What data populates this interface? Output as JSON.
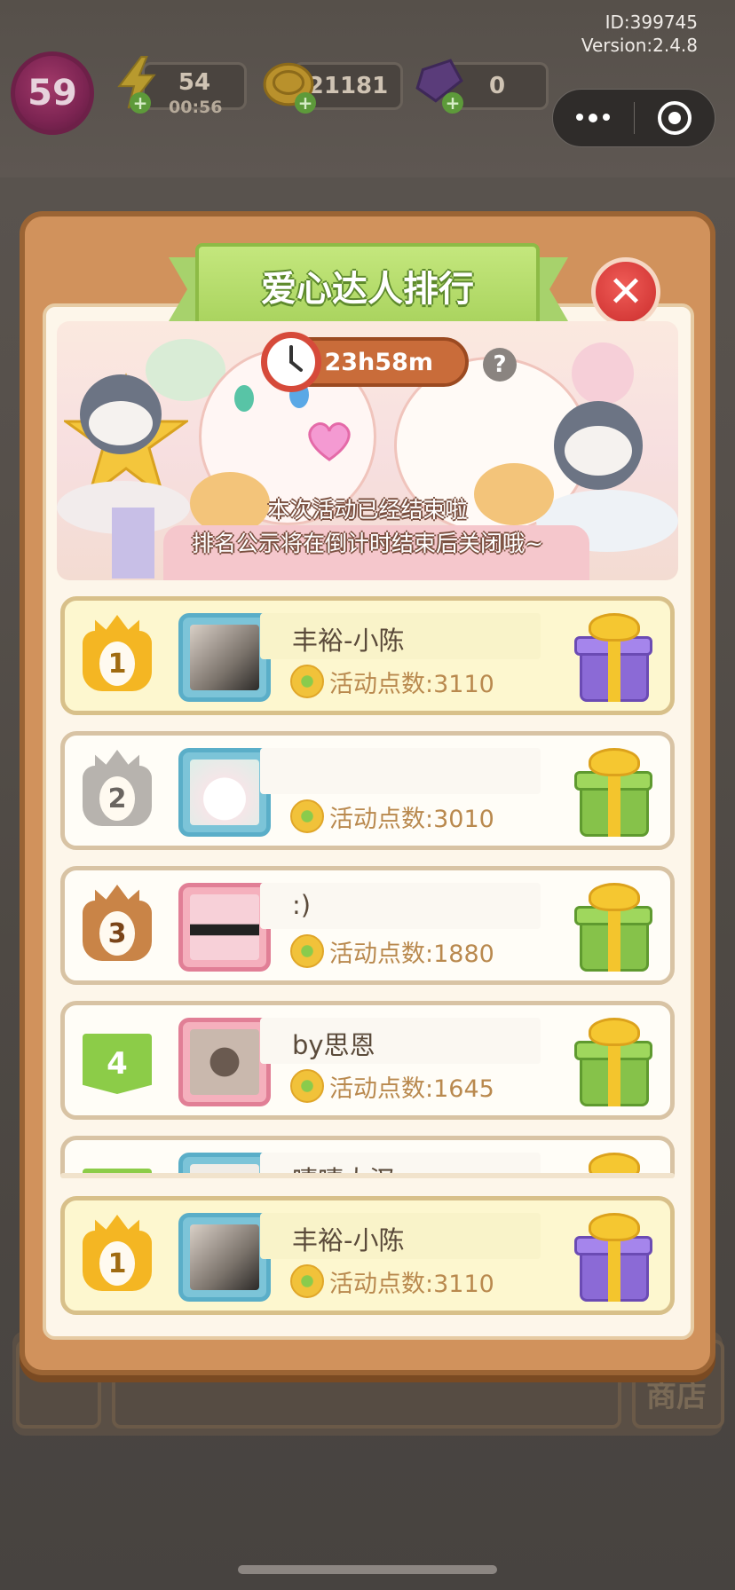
{
  "status_bar": {
    "id_text": "ID:399745",
    "version_text": "Version:2.4.8",
    "level": "59",
    "energy": "54",
    "energy_timer": "00:56",
    "coins": "21181",
    "gems": "0",
    "plus_icon": "plus-icon"
  },
  "capsule": {
    "more_icon": "more-dots-icon",
    "close_icon": "target-close-icon"
  },
  "modal": {
    "title": "爱心达人排行",
    "close_glyph": "✕",
    "countdown": "23h58m",
    "help_glyph": "?",
    "notice_line1": "本次活动已经结束啦",
    "notice_line2": "排名公示将在倒计时结束后关闭哦~"
  },
  "ranking": {
    "rows": [
      {
        "rank": "1",
        "name": "丰裕-小陈",
        "points": "活动点数:3110",
        "medal": "gold",
        "gift": "purple"
      },
      {
        "rank": "2",
        "name": "",
        "points": "活动点数:3010",
        "medal": "silver",
        "gift": "green"
      },
      {
        "rank": "3",
        "name": ":)",
        "points": "活动点数:1880",
        "medal": "bronze",
        "gift": "green"
      },
      {
        "rank": "4",
        "name": "by思恩",
        "points": "活动点数:1645",
        "medal": "flag",
        "gift": "green"
      },
      {
        "rank": "",
        "name": "嘻嘻大汉",
        "points": "",
        "medal": "flag",
        "gift": "green"
      }
    ],
    "my_rank": {
      "rank": "1",
      "name": "丰裕-小陈",
      "points": "活动点数:3110",
      "medal": "gold",
      "gift": "purple"
    }
  },
  "background": {
    "shop_label": "商店"
  },
  "colors": {
    "modal_frame": "#d1925c",
    "banner_green": "#a9d35e",
    "close_red": "#d63b39",
    "first_row_bg": "#fdf7cf",
    "points_text": "#b9894e"
  }
}
